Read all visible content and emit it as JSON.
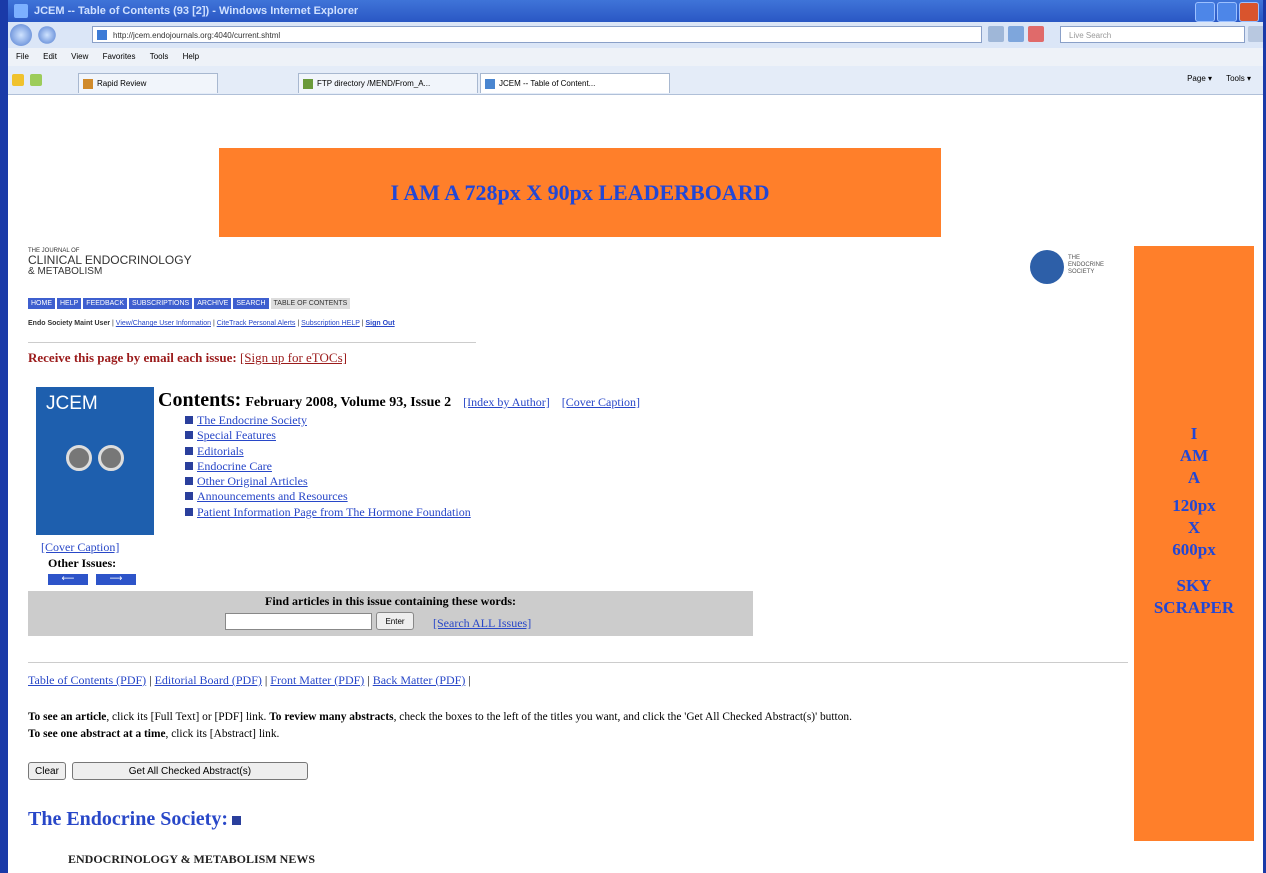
{
  "window": {
    "title": "JCEM -- Table of Contents (93 [2]) - Windows Internet Explorer"
  },
  "address": {
    "url": "http://jcem.endojournals.org:4040/current.shtml",
    "search_placeholder": "Live Search"
  },
  "menu": [
    "File",
    "Edit",
    "View",
    "Favorites",
    "Tools",
    "Help"
  ],
  "tabs": [
    "Rapid Review",
    "FTP directory /MEND/From_A...",
    "JCEM -- Table of Content..."
  ],
  "commandbar": [
    "Page ▾",
    "Tools ▾"
  ],
  "ads": {
    "leaderboard": "I AM A 728px X 90px LEADERBOARD",
    "skyscraper": [
      "I",
      "AM",
      "A",
      "",
      "120px",
      "X",
      "600px",
      "",
      "SKY",
      "SCRAPER"
    ]
  },
  "journal": {
    "line1": "THE JOURNAL OF",
    "line2": "CLINICAL ENDOCRINOLOGY",
    "line3": "& METABOLISM"
  },
  "society": {
    "lines": [
      "THE",
      "ENDOCRINE",
      "SOCIETY"
    ]
  },
  "nav": [
    "HOME",
    "HELP",
    "FEEDBACK",
    "SUBSCRIPTIONS",
    "ARCHIVE",
    "SEARCH",
    "TABLE OF CONTENTS"
  ],
  "userline": {
    "user": "Endo Society Maint User",
    "links": [
      "View/Change User Information",
      "CiteTrack Personal Alerts",
      "Subscription HELP",
      "Sign Out"
    ]
  },
  "receive": {
    "text": "Receive this page by email each issue:",
    "link": "[Sign up for eTOCs]"
  },
  "cover": {
    "title": "JCEM",
    "caption": "[Cover Caption]",
    "other_issues": "Other Issues:"
  },
  "contents": {
    "heading": "Contents:",
    "issue": "February 2008, Volume 93, Issue 2",
    "link1": "[Index by Author]",
    "link2": "[Cover Caption]"
  },
  "toc": [
    "The Endocrine Society",
    "Special Features",
    "Editorials",
    "Endocrine Care",
    "Other Original Articles",
    "Announcements and Resources",
    "Patient Information Page from The Hormone Foundation"
  ],
  "find": {
    "label": "Find articles in this issue containing these words:",
    "button": "Enter",
    "link": "[Search ALL Issues]"
  },
  "pdf": [
    "Table of Contents (PDF)",
    "Editorial Board (PDF)",
    "Front Matter (PDF)",
    "Back Matter (PDF)"
  ],
  "instructions": {
    "a": "To see an article",
    "b": ", click its [Full Text] or [PDF] link. ",
    "c": "To review many abstracts",
    "d": ", check the boxes to the left of the titles you want, and click the 'Get All Checked Abstract(s)' button.",
    "e": "To see one abstract at a time",
    "f": ", click its [Abstract] link."
  },
  "buttons": {
    "clear": "Clear",
    "get_all": "Get All Checked Abstract(s)"
  },
  "section": {
    "title": "The Endocrine Society:",
    "subtitle": "ENDOCRINOLOGY & METABOLISM NEWS"
  }
}
